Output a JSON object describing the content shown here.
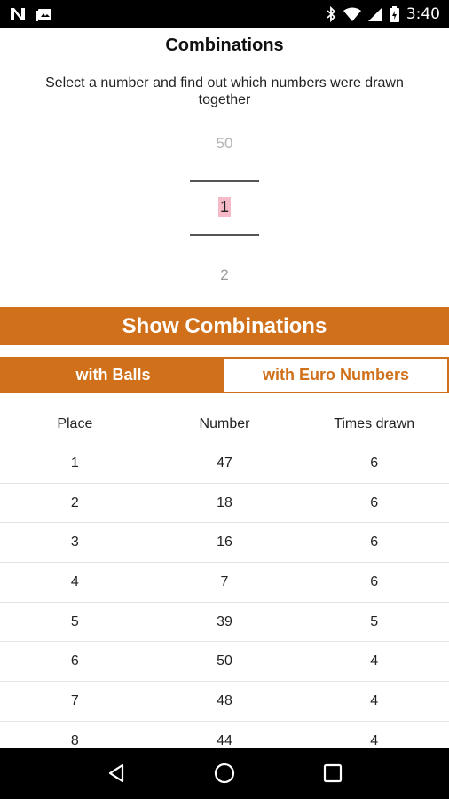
{
  "status_bar": {
    "time": "3:40",
    "icons": [
      "n-notification-icon",
      "photo-notification-icon",
      "bluetooth-icon",
      "wifi-icon",
      "signal-icon",
      "battery-icon"
    ]
  },
  "header": {
    "title": "Combinations",
    "subtitle": "Select a number and find out which numbers were drawn together"
  },
  "picker": {
    "previous": "50",
    "current": "1",
    "next": "2"
  },
  "show_button": {
    "label": "Show Combinations"
  },
  "toggle": {
    "options": [
      {
        "label": "with Balls",
        "selected": true
      },
      {
        "label": "with Euro Numbers",
        "selected": false
      }
    ]
  },
  "table": {
    "headers": [
      "Place",
      "Number",
      "Times drawn"
    ],
    "rows": [
      [
        "1",
        "47",
        "6"
      ],
      [
        "2",
        "18",
        "6"
      ],
      [
        "3",
        "16",
        "6"
      ],
      [
        "4",
        "7",
        "6"
      ],
      [
        "5",
        "39",
        "5"
      ],
      [
        "6",
        "50",
        "4"
      ],
      [
        "7",
        "48",
        "4"
      ],
      [
        "8",
        "44",
        "4"
      ]
    ]
  },
  "colors": {
    "accent": "#d0701b",
    "highlight": "#f6b9c8"
  },
  "nav_bar": {
    "icons": [
      "back-icon",
      "home-icon",
      "recents-icon"
    ]
  }
}
